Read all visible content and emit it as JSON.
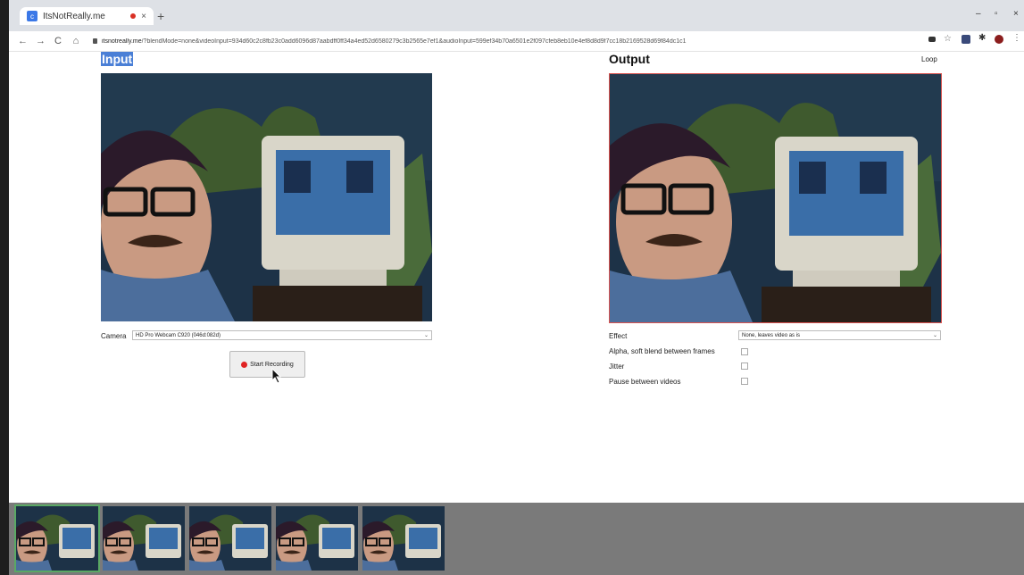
{
  "browser": {
    "tab_title": "ItsNotReally.me",
    "tab_favicon": "c",
    "tab_close": "×",
    "new_tab": "+",
    "url_domain": "itsnotreally.me",
    "url_path": "/?blendMode=none&videoInput=934d60c2c8fb23c0add6096d87aabdff0ff34a4ed52d6580279c3b2565e7ef1&audioInput=599ef34b70a6501e2f097cfeb8eb10e4ef8d8d9f7cc18b2169528d69f84dc1c1",
    "nav": {
      "back": "←",
      "forward": "→",
      "reload": "C",
      "home": "⌂"
    },
    "window_controls": {
      "minimize": "–",
      "maximize": "▫",
      "close": "×"
    }
  },
  "input": {
    "title": "Input",
    "camera_label": "Camera",
    "camera_value": "HD Pro Webcam C920 (046d:082d)",
    "record_button": "Start Recording"
  },
  "output": {
    "title": "Output",
    "loop_link": "Loop",
    "effect_label": "Effect",
    "effect_value": "None, leaves video as is",
    "options": [
      {
        "label": "Alpha, soft blend between frames",
        "checked": false
      },
      {
        "label": "Jitter",
        "checked": false
      },
      {
        "label": "Pause between videos",
        "checked": false
      }
    ]
  },
  "filmstrip": {
    "thumbnail_count": 5,
    "selected_index": 0
  },
  "colors": {
    "selection_highlight": "#4a7fd6",
    "output_border": "#d9534f",
    "record_dot": "#e02424",
    "filmstrip_bg": "#7a7a7a",
    "selected_thumb": "#5aa864"
  }
}
